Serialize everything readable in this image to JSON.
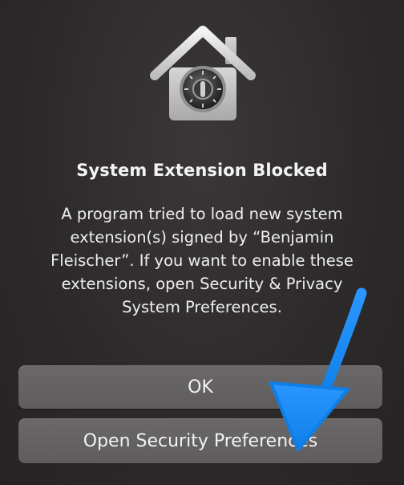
{
  "dialog": {
    "title": "System Extension Blocked",
    "message_lines": [
      "A program tried to load new system",
      "extension(s) signed by “Benjamin",
      "Fleischer”. If you want to enable these",
      "extensions, open Security & Privacy",
      "System Preferences."
    ],
    "icon": "security-house-vault-icon"
  },
  "buttons": {
    "ok_label": "OK",
    "open_prefs_label": "Open Security Preferences"
  },
  "annotation": {
    "icon": "pointer-arrow-icon",
    "color": "#1a8cf5"
  },
  "colors": {
    "background": "#2c292b",
    "button": "#646163",
    "text": "#ffffff"
  }
}
